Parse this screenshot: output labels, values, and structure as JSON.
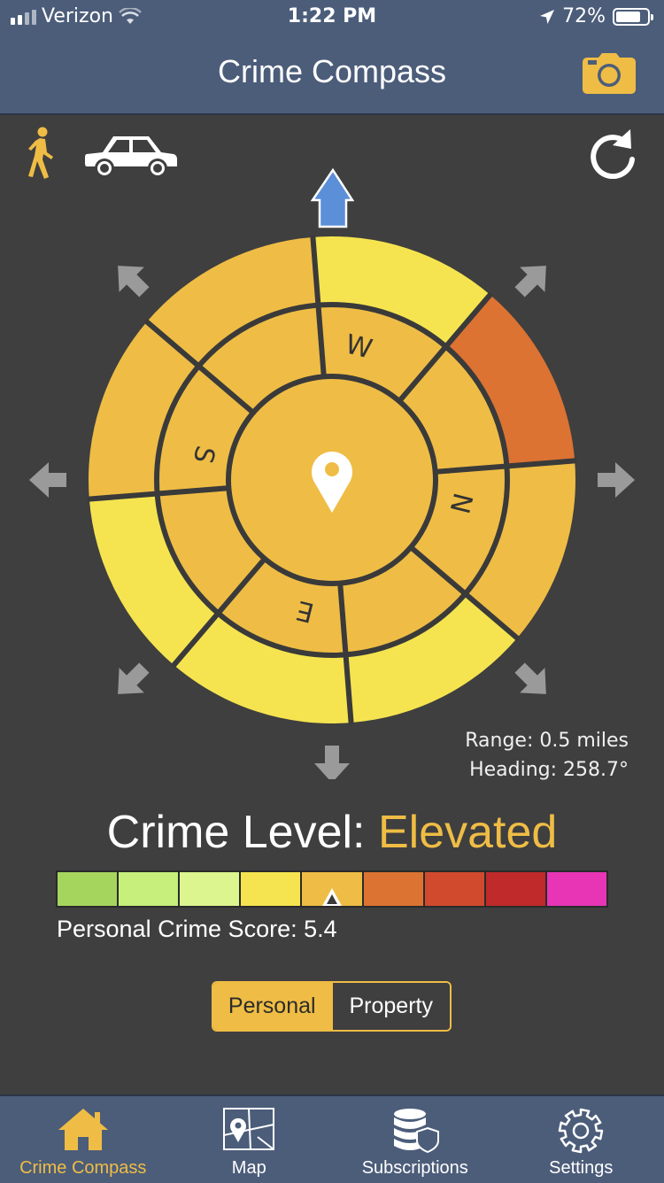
{
  "status": {
    "carrier": "Verizon",
    "time": "1:22 PM",
    "battery": "72%",
    "battery_level": 0.72
  },
  "header": {
    "title": "Crime Compass"
  },
  "compass": {
    "inner_labels": {
      "w": "W",
      "s": "S",
      "n": "N",
      "e": "E"
    },
    "colors": {
      "yellow": "#f5e44f",
      "orange": "#efbd45",
      "dark_orange": "#dc7332",
      "pointer": "#5b8fd8",
      "arrow": "#9a9a9a"
    }
  },
  "readout": {
    "range": "Range: 0.5 miles",
    "heading": "Heading: 258.7°"
  },
  "crime_level": {
    "label": "Crime Level:",
    "value": "Elevated"
  },
  "scale": {
    "colors": [
      "#a6d55e",
      "#c6ef7c",
      "#dcf58f",
      "#f5e44f",
      "#efbd45",
      "#dc7332",
      "#d24a2e",
      "#c02a2a",
      "#e835b6"
    ],
    "marker_index": 4
  },
  "score": {
    "text": "Personal Crime Score: 5.4"
  },
  "toggle": {
    "personal": "Personal",
    "property": "Property"
  },
  "tabs": [
    {
      "label": "Crime Compass",
      "icon": "home-icon"
    },
    {
      "label": "Map",
      "icon": "map-icon"
    },
    {
      "label": "Subscriptions",
      "icon": "subscriptions-icon"
    },
    {
      "label": "Settings",
      "icon": "gear-icon"
    }
  ]
}
